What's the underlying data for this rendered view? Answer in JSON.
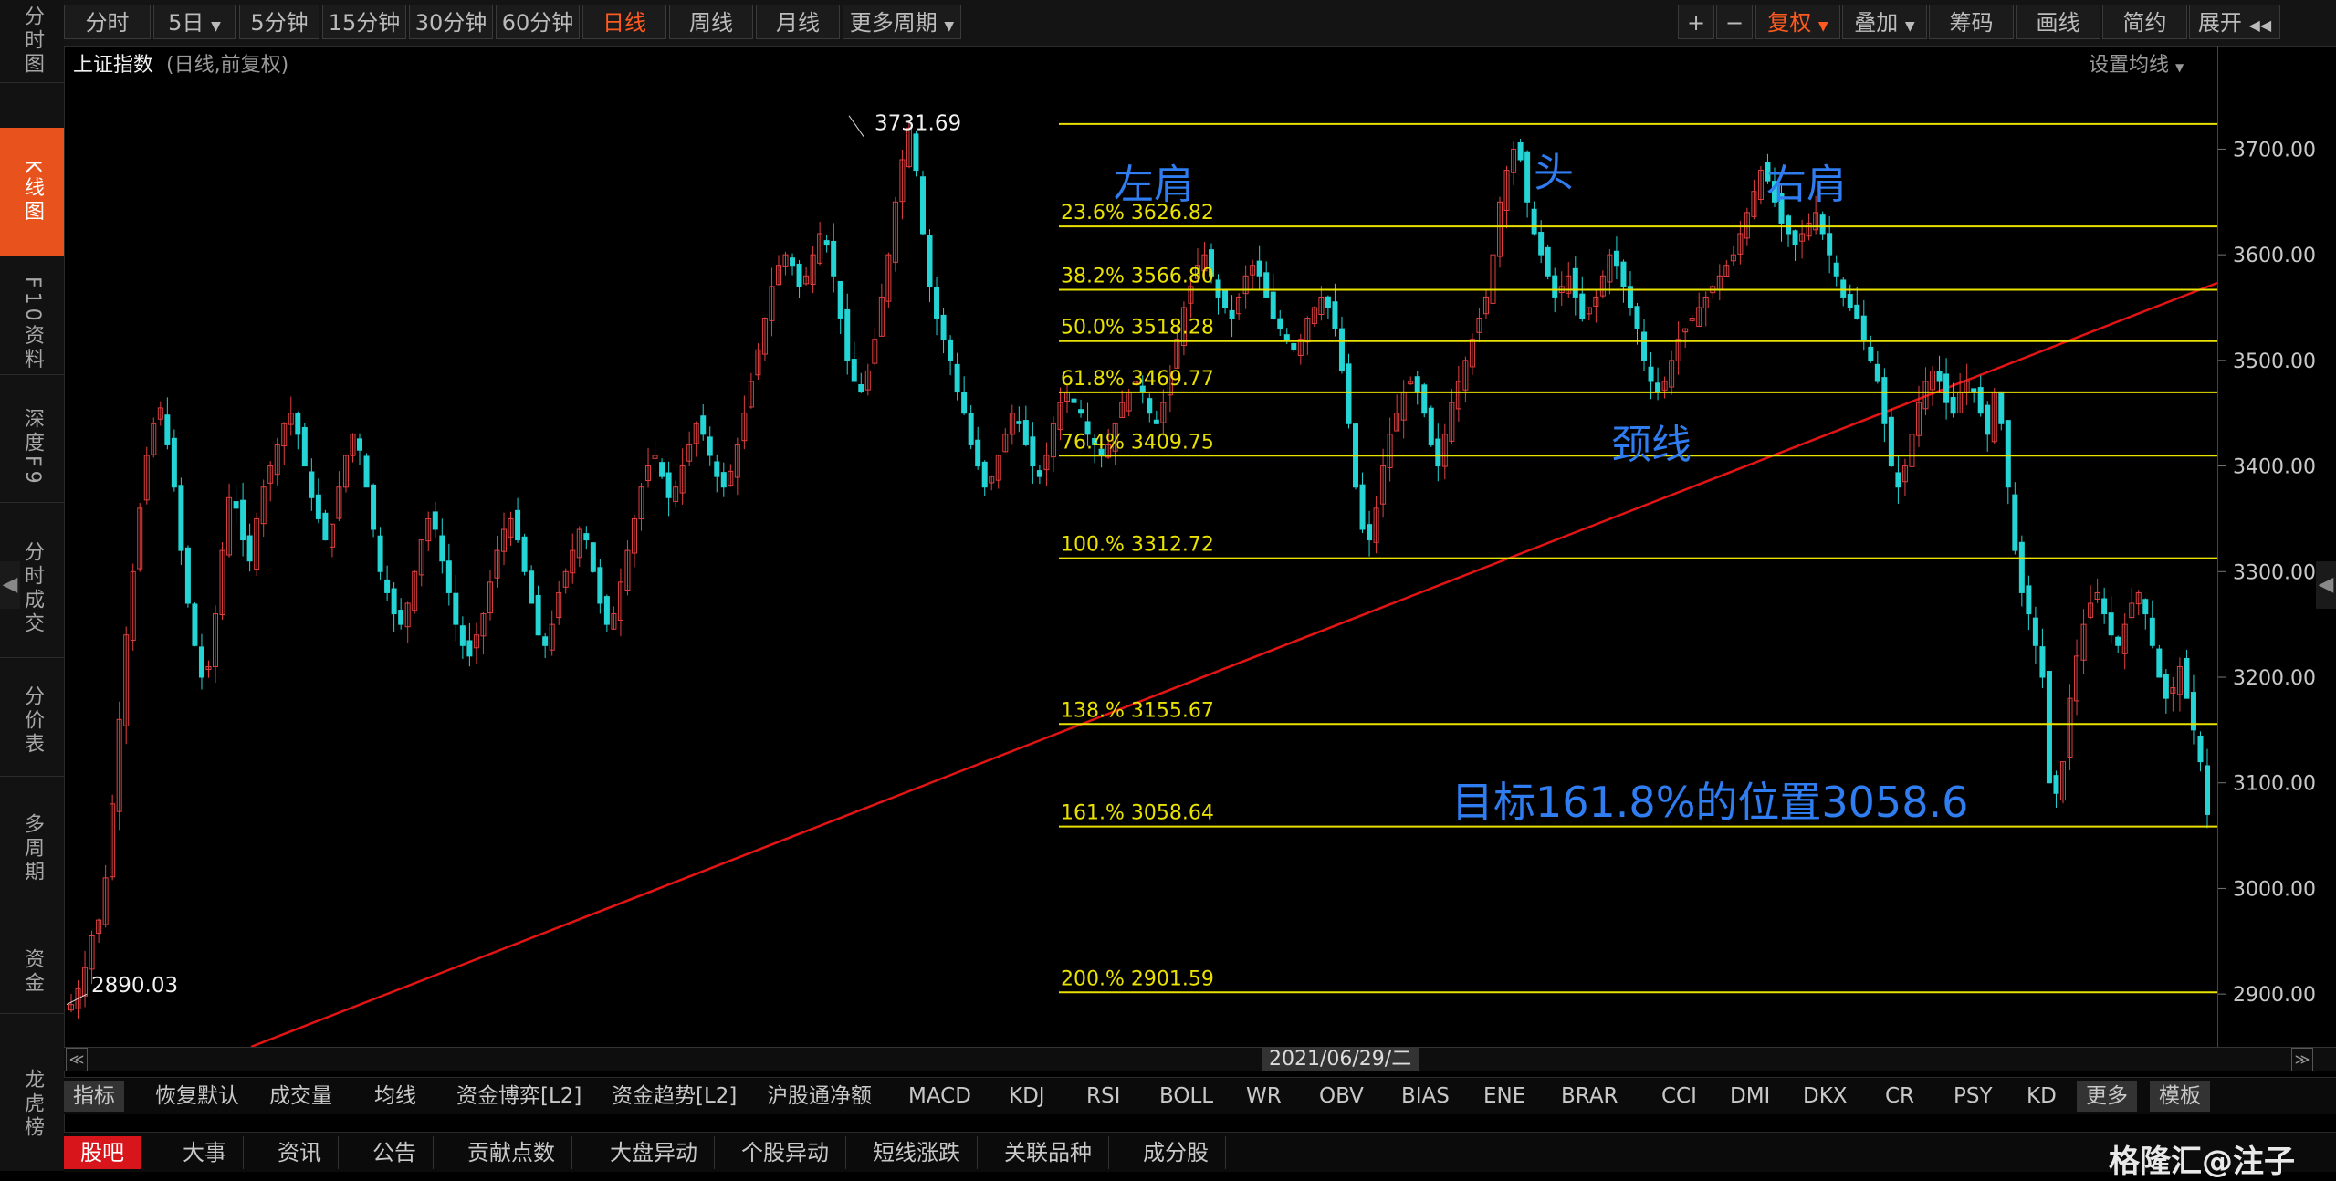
{
  "sidebar": {
    "items": [
      {
        "label": "分时图"
      },
      {
        "label": "K线图",
        "active": true
      },
      {
        "label": "F10资料"
      },
      {
        "label": "深度F9"
      },
      {
        "label": "分时成交"
      },
      {
        "label": "分价表"
      },
      {
        "label": "多周期"
      },
      {
        "label": "资金"
      },
      {
        "label": "龙虎榜"
      }
    ]
  },
  "toolbar": {
    "periods": [
      "分时",
      "5日",
      "5分钟",
      "15分钟",
      "30分钟",
      "60分钟",
      "日线",
      "周线",
      "月线",
      "更多周期"
    ],
    "active_period": "日线",
    "right": [
      "复权",
      "叠加",
      "筹码",
      "画线",
      "简约",
      "展开"
    ],
    "zoom_in": "+",
    "zoom_out": "−"
  },
  "header": {
    "title": "上证指数",
    "subtitle": "(日线,前复权)",
    "ma_settings": "设置均线"
  },
  "accent_colors": {
    "up": "#e04040",
    "down": "#25d4d4",
    "fib": "#e9e100",
    "trend": "#e41414",
    "annotation": "#2f7df0",
    "active": "#ff5a1f"
  },
  "chart_data": {
    "type": "candlestick",
    "title": "上证指数",
    "ylim": [
      2850,
      3760
    ],
    "y_ticks": [
      "3700.00",
      "3600.00",
      "3500.00",
      "3400.00",
      "3300.00",
      "3200.00",
      "3100.00",
      "3000.00",
      "2900.00"
    ],
    "y_values": [
      3700,
      3600,
      3500,
      3400,
      3300,
      3200,
      3100,
      3000,
      2900
    ],
    "high_label": "3731.69",
    "low_label": "2890.03",
    "date_label": "2021/06/29/二",
    "fib_levels": [
      {
        "label": "23.6% 3626.82",
        "value": 3626.82,
        "show_label": true
      },
      {
        "label": "38.2% 3566.80",
        "value": 3566.8,
        "show_label": true
      },
      {
        "label": "50.0% 3518.28",
        "value": 3518.28,
        "show_label": true
      },
      {
        "label": "61.8% 3469.77",
        "value": 3469.77,
        "show_label": true
      },
      {
        "label": "76.4% 3409.75",
        "value": 3409.75,
        "show_label": true
      },
      {
        "label": "100.% 3312.72",
        "value": 3312.72,
        "show_label": true
      },
      {
        "label": "138.% 3155.67",
        "value": 3155.67,
        "show_label": true
      },
      {
        "label": "161.% 3058.64",
        "value": 3058.64,
        "show_label": true
      },
      {
        "label": "200.% 2901.59",
        "value": 2901.59,
        "show_label": true
      },
      {
        "label": "",
        "value": 3723.85,
        "show_label": false
      }
    ],
    "annotations": [
      "左肩",
      "头",
      "右肩",
      "颈线",
      "目标161.8%的位置3058.6"
    ],
    "closes": [
      2890,
      2905,
      2925,
      2955,
      2970,
      3010,
      3080,
      3160,
      3240,
      3300,
      3360,
      3410,
      3440,
      3455,
      3420,
      3380,
      3320,
      3270,
      3230,
      3200,
      3210,
      3260,
      3320,
      3370,
      3360,
      3330,
      3310,
      3350,
      3380,
      3400,
      3420,
      3440,
      3450,
      3430,
      3400,
      3370,
      3350,
      3330,
      3345,
      3380,
      3410,
      3430,
      3415,
      3380,
      3340,
      3300,
      3280,
      3260,
      3250,
      3270,
      3300,
      3330,
      3350,
      3340,
      3310,
      3280,
      3250,
      3230,
      3220,
      3240,
      3260,
      3290,
      3320,
      3340,
      3350,
      3330,
      3300,
      3270,
      3240,
      3230,
      3250,
      3280,
      3300,
      3320,
      3340,
      3330,
      3300,
      3270,
      3250,
      3260,
      3290,
      3320,
      3350,
      3380,
      3400,
      3410,
      3390,
      3370,
      3380,
      3400,
      3420,
      3440,
      3430,
      3410,
      3390,
      3380,
      3395,
      3420,
      3450,
      3480,
      3510,
      3540,
      3570,
      3590,
      3600,
      3590,
      3570,
      3580,
      3600,
      3620,
      3610,
      3580,
      3540,
      3500,
      3480,
      3470,
      3490,
      3520,
      3560,
      3600,
      3650,
      3690,
      3720,
      3680,
      3620,
      3570,
      3540,
      3520,
      3500,
      3470,
      3450,
      3420,
      3400,
      3380,
      3390,
      3410,
      3430,
      3450,
      3440,
      3420,
      3400,
      3390,
      3410,
      3440,
      3460,
      3470,
      3460,
      3450,
      3430,
      3420,
      3410,
      3420,
      3440,
      3460,
      3470,
      3480,
      3470,
      3450,
      3440,
      3460,
      3490,
      3520,
      3550,
      3570,
      3590,
      3600,
      3580,
      3560,
      3550,
      3540,
      3560,
      3580,
      3590,
      3580,
      3560,
      3540,
      3530,
      3520,
      3510,
      3520,
      3540,
      3550,
      3560,
      3550,
      3530,
      3490,
      3440,
      3380,
      3340,
      3330,
      3360,
      3400,
      3430,
      3450,
      3470,
      3480,
      3470,
      3450,
      3420,
      3400,
      3430,
      3460,
      3480,
      3500,
      3520,
      3540,
      3560,
      3600,
      3650,
      3680,
      3700,
      3690,
      3650,
      3620,
      3600,
      3580,
      3560,
      3570,
      3580,
      3560,
      3540,
      3550,
      3560,
      3580,
      3600,
      3590,
      3570,
      3550,
      3530,
      3500,
      3480,
      3470,
      3480,
      3500,
      3520,
      3530,
      3540,
      3550,
      3560,
      3570,
      3580,
      3590,
      3600,
      3620,
      3640,
      3660,
      3680,
      3670,
      3650,
      3630,
      3620,
      3610,
      3620,
      3630,
      3640,
      3620,
      3600,
      3580,
      3560,
      3550,
      3540,
      3520,
      3500,
      3480,
      3440,
      3400,
      3380,
      3400,
      3430,
      3460,
      3480,
      3490,
      3480,
      3460,
      3450,
      3470,
      3480,
      3470,
      3450,
      3430,
      3470,
      3440,
      3380,
      3320,
      3280,
      3260,
      3230,
      3200,
      3100,
      3090,
      3120,
      3180,
      3220,
      3250,
      3270,
      3280,
      3260,
      3240,
      3230,
      3250,
      3270,
      3280,
      3260,
      3230,
      3200,
      3180,
      3190,
      3210,
      3180,
      3150,
      3120,
      3070
    ]
  },
  "indicators": [
    "指标",
    "恢复默认",
    "成交量",
    "均线",
    "资金博弈[L2]",
    "资金趋势[L2]",
    "沪股通净额",
    "MACD",
    "KDJ",
    "RSI",
    "BOLL",
    "WR",
    "OBV",
    "BIAS",
    "ENE",
    "BRAR",
    "CCI",
    "DMI",
    "DKX",
    "CR",
    "PSY",
    "KD",
    "更多",
    "模板"
  ],
  "tabs": [
    "股吧",
    "大事",
    "资讯",
    "公告",
    "贡献点数",
    "大盘异动",
    "个股异动",
    "短线涨跌",
    "关联品种",
    "成分股"
  ],
  "watermark": "格隆汇@注子"
}
